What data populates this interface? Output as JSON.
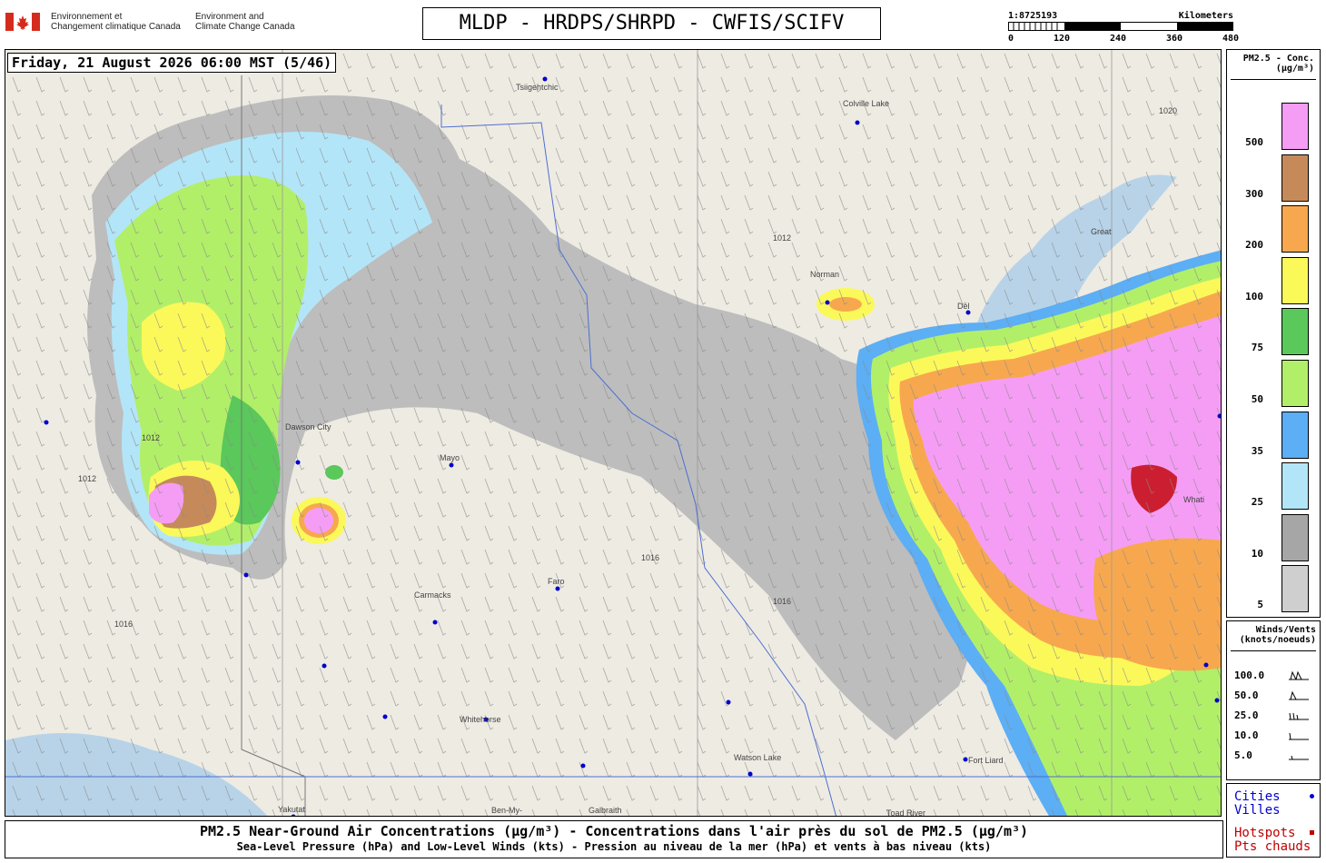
{
  "header": {
    "org_fr_line1": "Environnement et",
    "org_fr_line2": "Changement climatique Canada",
    "org_en_line1": "Environment and",
    "org_en_line2": "Climate Change Canada",
    "title": "MLDP - HRDPS/SHRPD - CWFIS/SCIFV"
  },
  "scale": {
    "ratio": "1:8725193",
    "unit": "Kilometers",
    "ticks": [
      "0",
      "120",
      "240",
      "360",
      "480"
    ]
  },
  "map": {
    "timestamp": "Friday, 21 August 2026 06:00 MST (5/46)",
    "cities": [
      "Tsiigehtchic",
      "Colville Lake",
      "Dawson City",
      "Mayo",
      "Carmacks",
      "Faro",
      "Whitehorse",
      "Watson Lake",
      "Fort Liard",
      "Yakutat",
      "Ben-My-",
      "Galbraith",
      "Toad River",
      "Whati",
      "Great",
      "Dél",
      "Norman"
    ],
    "isobars": [
      "1012",
      "1016",
      "1020"
    ]
  },
  "pm_legend": {
    "title_line1": "PM2.5 - Conc.",
    "title_line2": "(μg/m³)",
    "levels": [
      {
        "label": "500",
        "color": "#f59df5"
      },
      {
        "label": "300",
        "color": "#c68a5a"
      },
      {
        "label": "200",
        "color": "#f7a84e"
      },
      {
        "label": "100",
        "color": "#fbf95a"
      },
      {
        "label": "75",
        "color": "#5ac85a"
      },
      {
        "label": "50",
        "color": "#b2ef69"
      },
      {
        "label": "35",
        "color": "#5caef5"
      },
      {
        "label": "25",
        "color": "#b3e5f8"
      },
      {
        "label": "10",
        "color": "#a6a6a6"
      },
      {
        "label": "5",
        "color": "#cfcfcf"
      }
    ]
  },
  "wind_legend": {
    "title_line1": "Winds/Vents",
    "title_line2": "(knots/noeuds)",
    "speeds": [
      "100.0",
      "50.0",
      "25.0",
      "10.0",
      "5.0"
    ]
  },
  "cities_legend": {
    "cities_en": "Cities",
    "cities_fr": "Villes",
    "hotspots_en": "Hotspots",
    "hotspots_fr": "Pts chauds",
    "city_color": "#0000cc",
    "hotspot_color": "#c00000"
  },
  "caption": {
    "line1": "PM2.5 Near-Ground Air Concentrations (μg/m³) - Concentrations dans l'air près du sol de PM2.5 (μg/m³)",
    "line2": "Sea-Level Pressure (hPa) and Low-Level Winds (kts) - Pression au niveau de la mer (hPa) et vents à bas niveau (kts)"
  }
}
